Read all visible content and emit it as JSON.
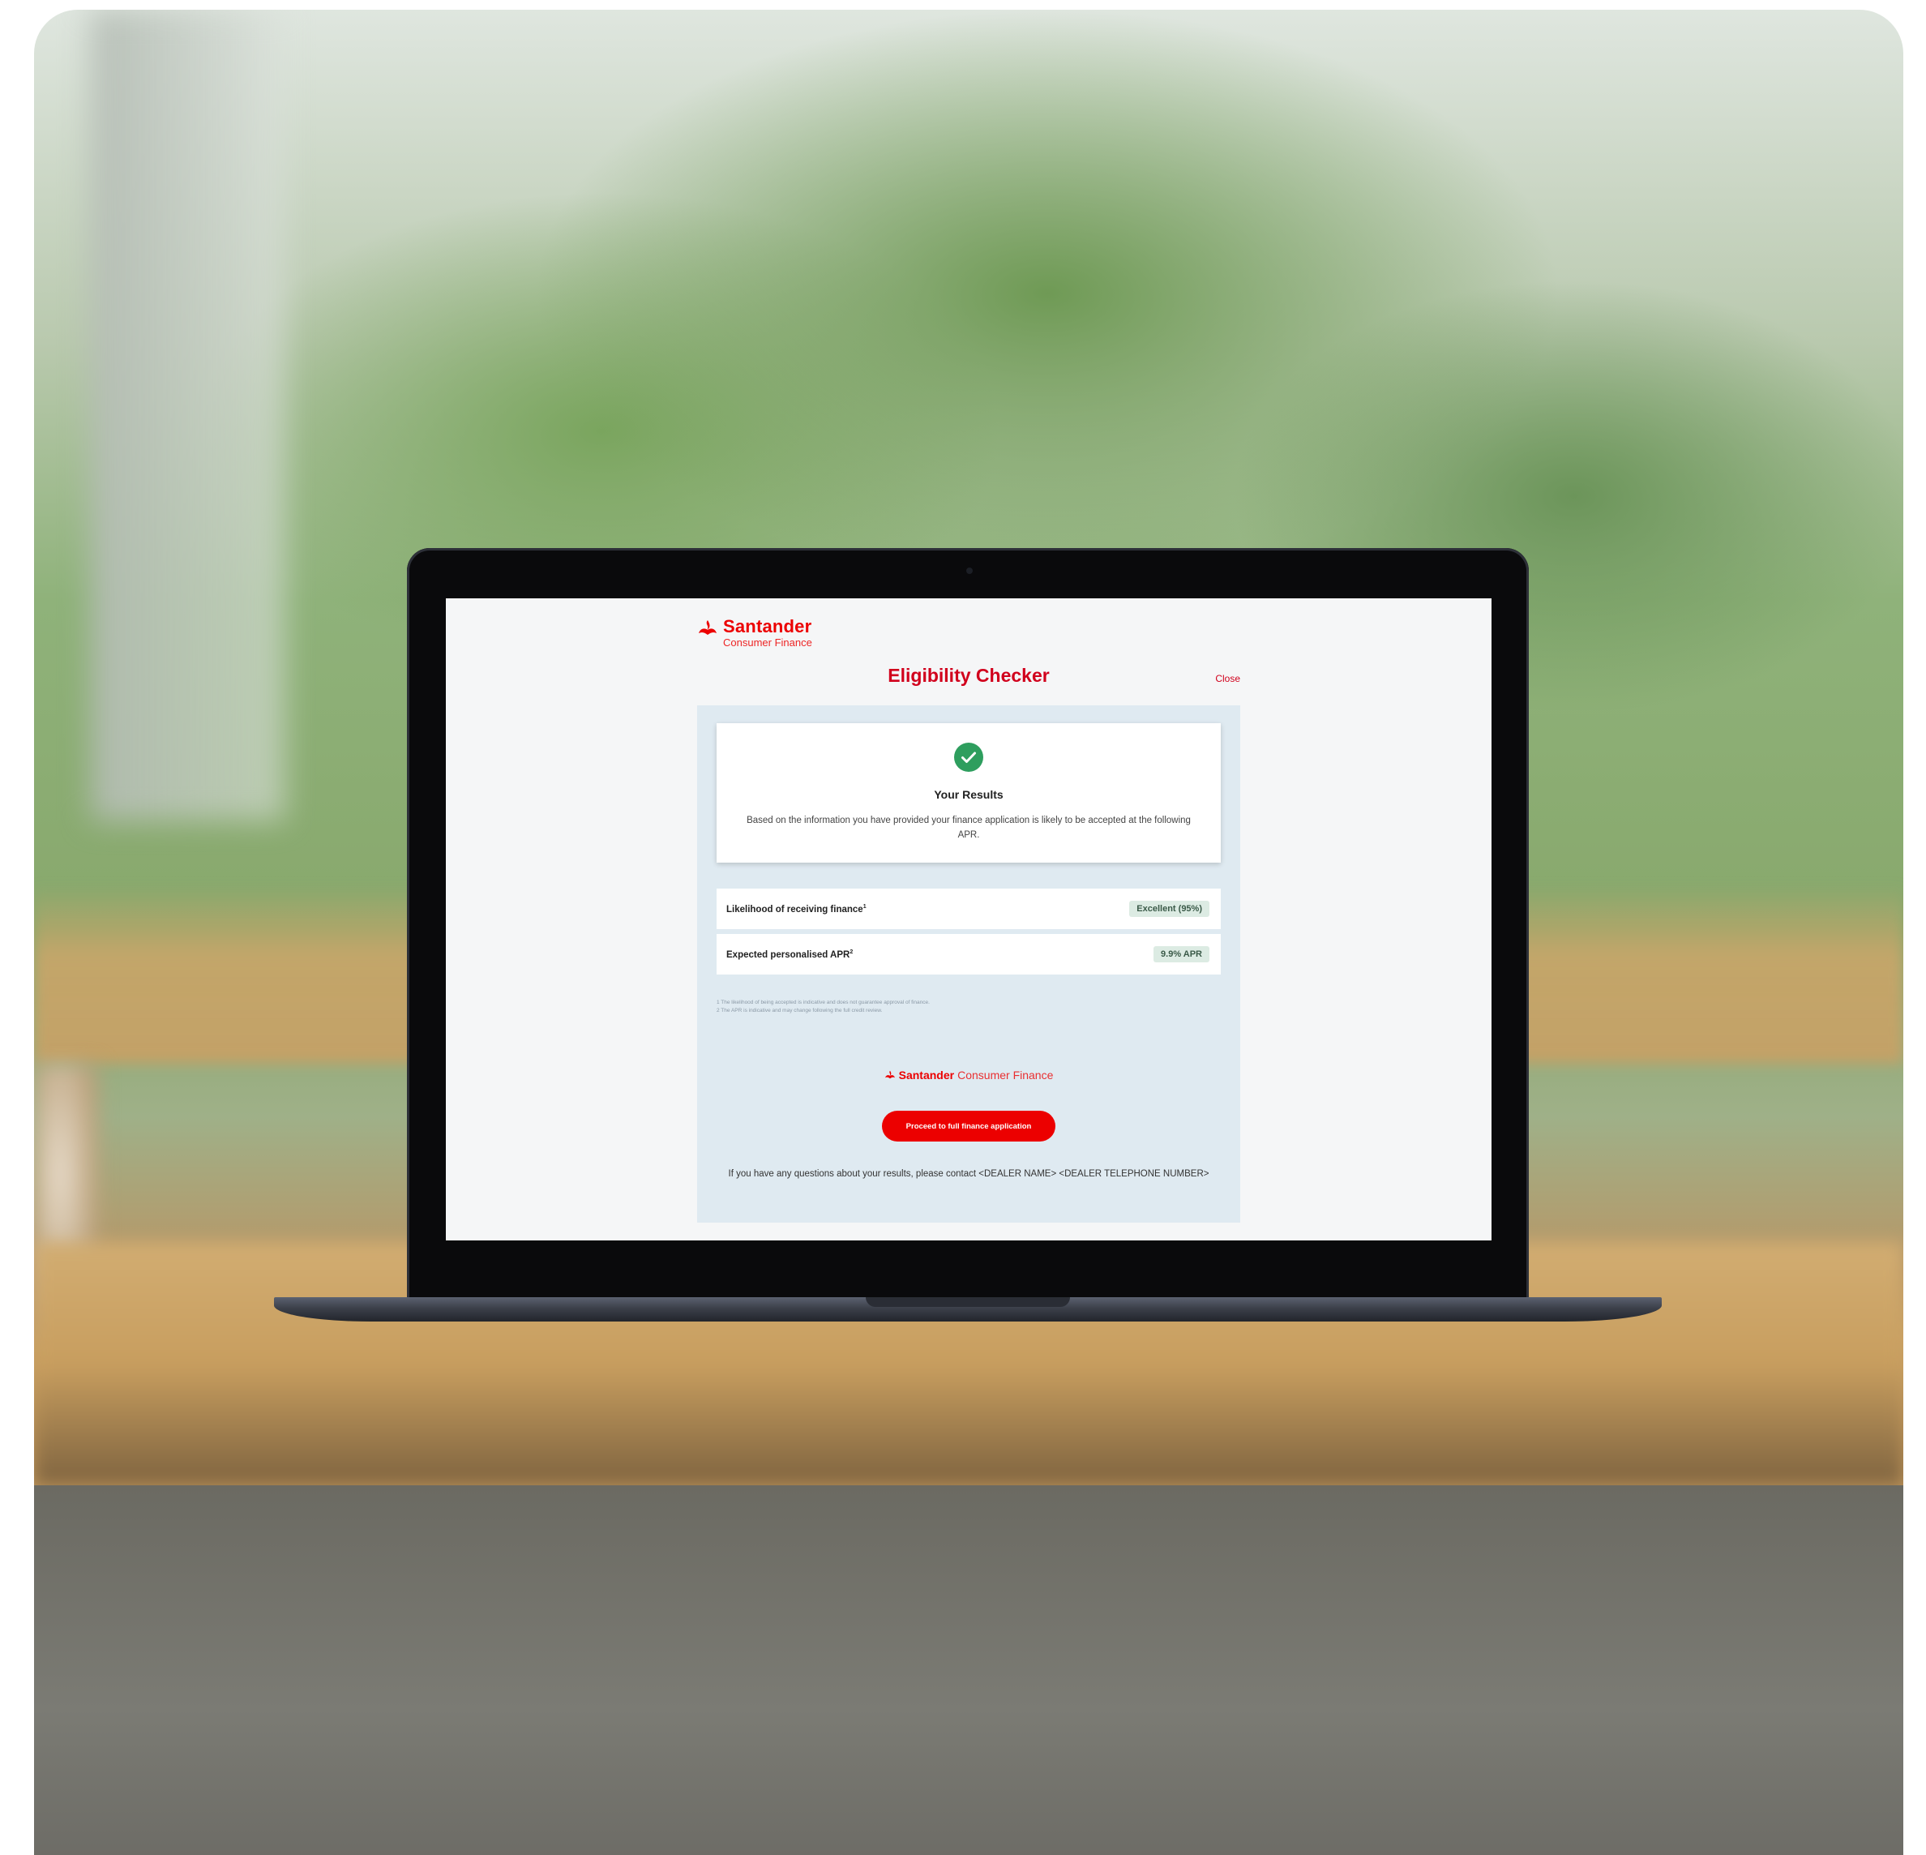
{
  "brand": {
    "name": "Santander",
    "sub": "Consumer Finance"
  },
  "header": {
    "title": "Eligibility Checker",
    "close_label": "Close"
  },
  "results": {
    "title": "Your Results",
    "text": "Based on the information you have provided your finance application is likely to be accepted at the following APR."
  },
  "rows": [
    {
      "label": "Likelihood of receiving finance",
      "sup": "1",
      "value": "Excellent (95%)"
    },
    {
      "label": "Expected personalised APR",
      "sup": "2",
      "value": "9.9% APR"
    }
  ],
  "footnotes": [
    "1 The likelihood of being accepted is indicative and does not guarantee approval of finance.",
    "2 The APR is indicative and may change following the full credit review."
  ],
  "footer": {
    "brand": "Santander",
    "sub": "Consumer Finance",
    "proceed_label": "Proceed to full finance application",
    "contact_text": "If you have any questions about your results, please contact <DEALER NAME> <DEALER TELEPHONE NUMBER>"
  },
  "colors": {
    "brand_red": "#ec0000",
    "title_red": "#d1001c",
    "success_green": "#2e9e5e",
    "panel_bg": "#dfeaf1"
  }
}
